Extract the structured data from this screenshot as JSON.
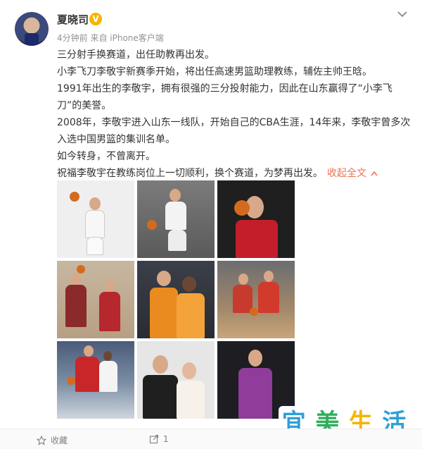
{
  "header": {
    "username": "夏晓司",
    "vip_badge": "V",
    "meta": "4分钟前 来自 iPhone客户端"
  },
  "post": {
    "paragraphs": [
      "三分射手换赛道，出任助教再出发。",
      "小李飞刀李敬宇新赛季开始，将出任高速男篮助理教练，辅佐主帅王晗。",
      "1991年出生的李敬宇，拥有很强的三分投射能力，因此在山东赢得了“小李飞刀”的美誉。",
      "2008年，李敬宇进入山东一线队，开始自己的CBA生涯，14年来，李敬宇曾多次入选中国男篮的集训名单。",
      "如今转身，不曾离开。",
      "祝福李敬宇在教练岗位上一切顺利，换个赛道，为梦再出发。"
    ],
    "collapse_label": "收起全文"
  },
  "photos": [
    {
      "name": "white-jersey-holding-ball"
    },
    {
      "name": "white-jersey-dribbling"
    },
    {
      "name": "red-jersey-portrait"
    },
    {
      "name": "red-jersey-team-huddle"
    },
    {
      "name": "orange-jersey-celebration"
    },
    {
      "name": "red-jersey-game-action"
    },
    {
      "name": "red-jersey-driving"
    },
    {
      "name": "wedding-photo"
    },
    {
      "name": "purple-jersey-portrait"
    }
  ],
  "footer": {
    "favorite_label": "收藏",
    "repost_count": "1"
  },
  "watermark": {
    "chars": [
      "宜",
      "美",
      "生",
      "活"
    ],
    "colors": [
      "#2f9fd6",
      "#2fae5a",
      "#f5b400",
      "#2f9fd6"
    ]
  },
  "colors": {
    "link": "#eb7350",
    "meta": "#939393",
    "vip": "#f7b500"
  }
}
